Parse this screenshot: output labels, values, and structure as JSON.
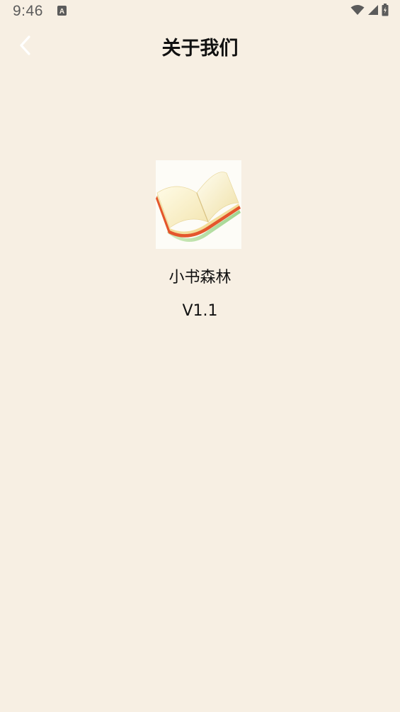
{
  "status_bar": {
    "time": "9:46",
    "icons": [
      "text-notification-icon",
      "wifi-icon",
      "cell-signal-icon",
      "battery-icon"
    ]
  },
  "header": {
    "back_icon": "chevron-left-icon",
    "title": "关于我们"
  },
  "main": {
    "logo_icon": "open-book-icon",
    "app_name": "小书森林",
    "version": "V1.1"
  },
  "colors": {
    "background": "#f7efe3",
    "text": "#111111",
    "status_icons": "#5b5b5b",
    "back_icon": "#ffffff"
  }
}
